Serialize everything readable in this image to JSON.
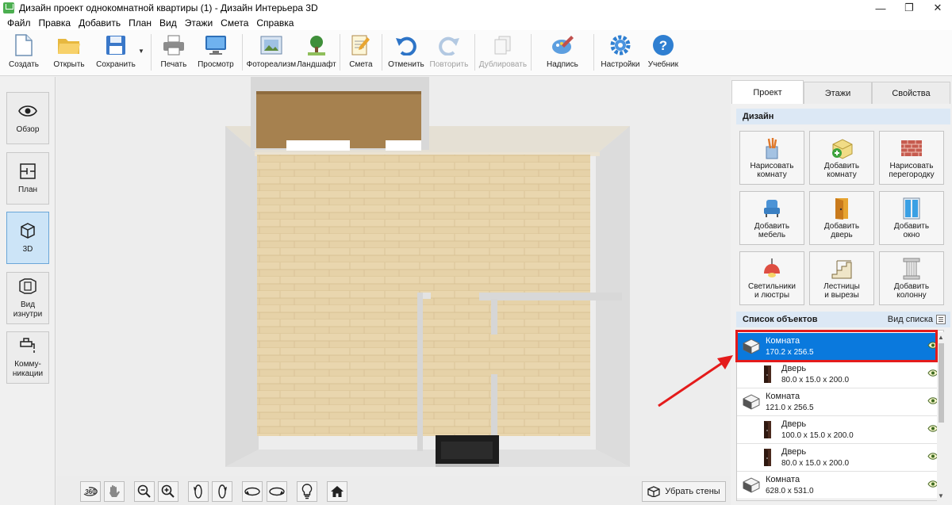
{
  "window": {
    "title": "Дизайн проект однокомнатной квартиры (1) - Дизайн Интерьера 3D",
    "minimize": "—",
    "maximize": "❐",
    "close": "✕"
  },
  "menu": [
    "Файл",
    "Правка",
    "Добавить",
    "План",
    "Вид",
    "Этажи",
    "Смета",
    "Справка"
  ],
  "toolbar": {
    "create": "Создать",
    "open": "Открыть",
    "save": "Сохранить",
    "print": "Печать",
    "preview": "Просмотр",
    "photorealism": "Фотореализм",
    "landscape": "Ландшафт",
    "estimate": "Смета",
    "undo": "Отменить",
    "redo": "Повторить",
    "duplicate": "Дублировать",
    "caption": "Надпись",
    "settings": "Настройки",
    "tutorial": "Учебник"
  },
  "left_nav": [
    {
      "label": "Обзор",
      "active": false
    },
    {
      "label": "План",
      "active": false
    },
    {
      "label": "3D",
      "active": true
    },
    {
      "label": "Вид изнутри",
      "active": false
    },
    {
      "label": "Комму-никации",
      "active": false
    }
  ],
  "viewport_controls": {
    "rotate360": "360",
    "remove_walls": "Убрать стены"
  },
  "tabs": [
    {
      "label": "Проект",
      "active": true
    },
    {
      "label": "Этажи",
      "active": false
    },
    {
      "label": "Свойства",
      "active": false
    }
  ],
  "design": {
    "header": "Дизайн",
    "buttons": [
      {
        "line1": "Нарисовать",
        "line2": "комнату",
        "icon": "pencils-icon"
      },
      {
        "line1": "Добавить",
        "line2": "комнату",
        "icon": "add-room-icon"
      },
      {
        "line1": "Нарисовать",
        "line2": "перегородку",
        "icon": "brick-wall-icon"
      },
      {
        "line1": "Добавить",
        "line2": "мебель",
        "icon": "armchair-icon"
      },
      {
        "line1": "Добавить",
        "line2": "дверь",
        "icon": "door-icon"
      },
      {
        "line1": "Добавить",
        "line2": "окно",
        "icon": "window-icon"
      },
      {
        "line1": "Светильники",
        "line2": "и люстры",
        "icon": "lamp-icon"
      },
      {
        "line1": "Лестницы",
        "line2": "и вырезы",
        "icon": "stairs-icon"
      },
      {
        "line1": "Добавить",
        "line2": "колонну",
        "icon": "column-icon"
      }
    ]
  },
  "objects": {
    "header": "Список объектов",
    "view_label": "Вид списка",
    "items": [
      {
        "name": "Комната",
        "dims": "170.2 x 256.5",
        "type": "room",
        "indent": false,
        "selected": true
      },
      {
        "name": "Дверь",
        "dims": "80.0 x 15.0 x 200.0",
        "type": "door",
        "indent": true,
        "selected": false
      },
      {
        "name": "Комната",
        "dims": "121.0 x 256.5",
        "type": "room",
        "indent": false,
        "selected": false
      },
      {
        "name": "Дверь",
        "dims": "100.0 x 15.0 x 200.0",
        "type": "door",
        "indent": true,
        "selected": false
      },
      {
        "name": "Дверь",
        "dims": "80.0 x 15.0 x 200.0",
        "type": "door",
        "indent": true,
        "selected": false
      },
      {
        "name": "Комната",
        "dims": "628.0 x 531.0",
        "type": "room",
        "indent": false,
        "selected": false
      }
    ]
  },
  "colors": {
    "accent": "#0a79dd",
    "highlight": "#e41b1b",
    "section": "#dce8f5"
  }
}
